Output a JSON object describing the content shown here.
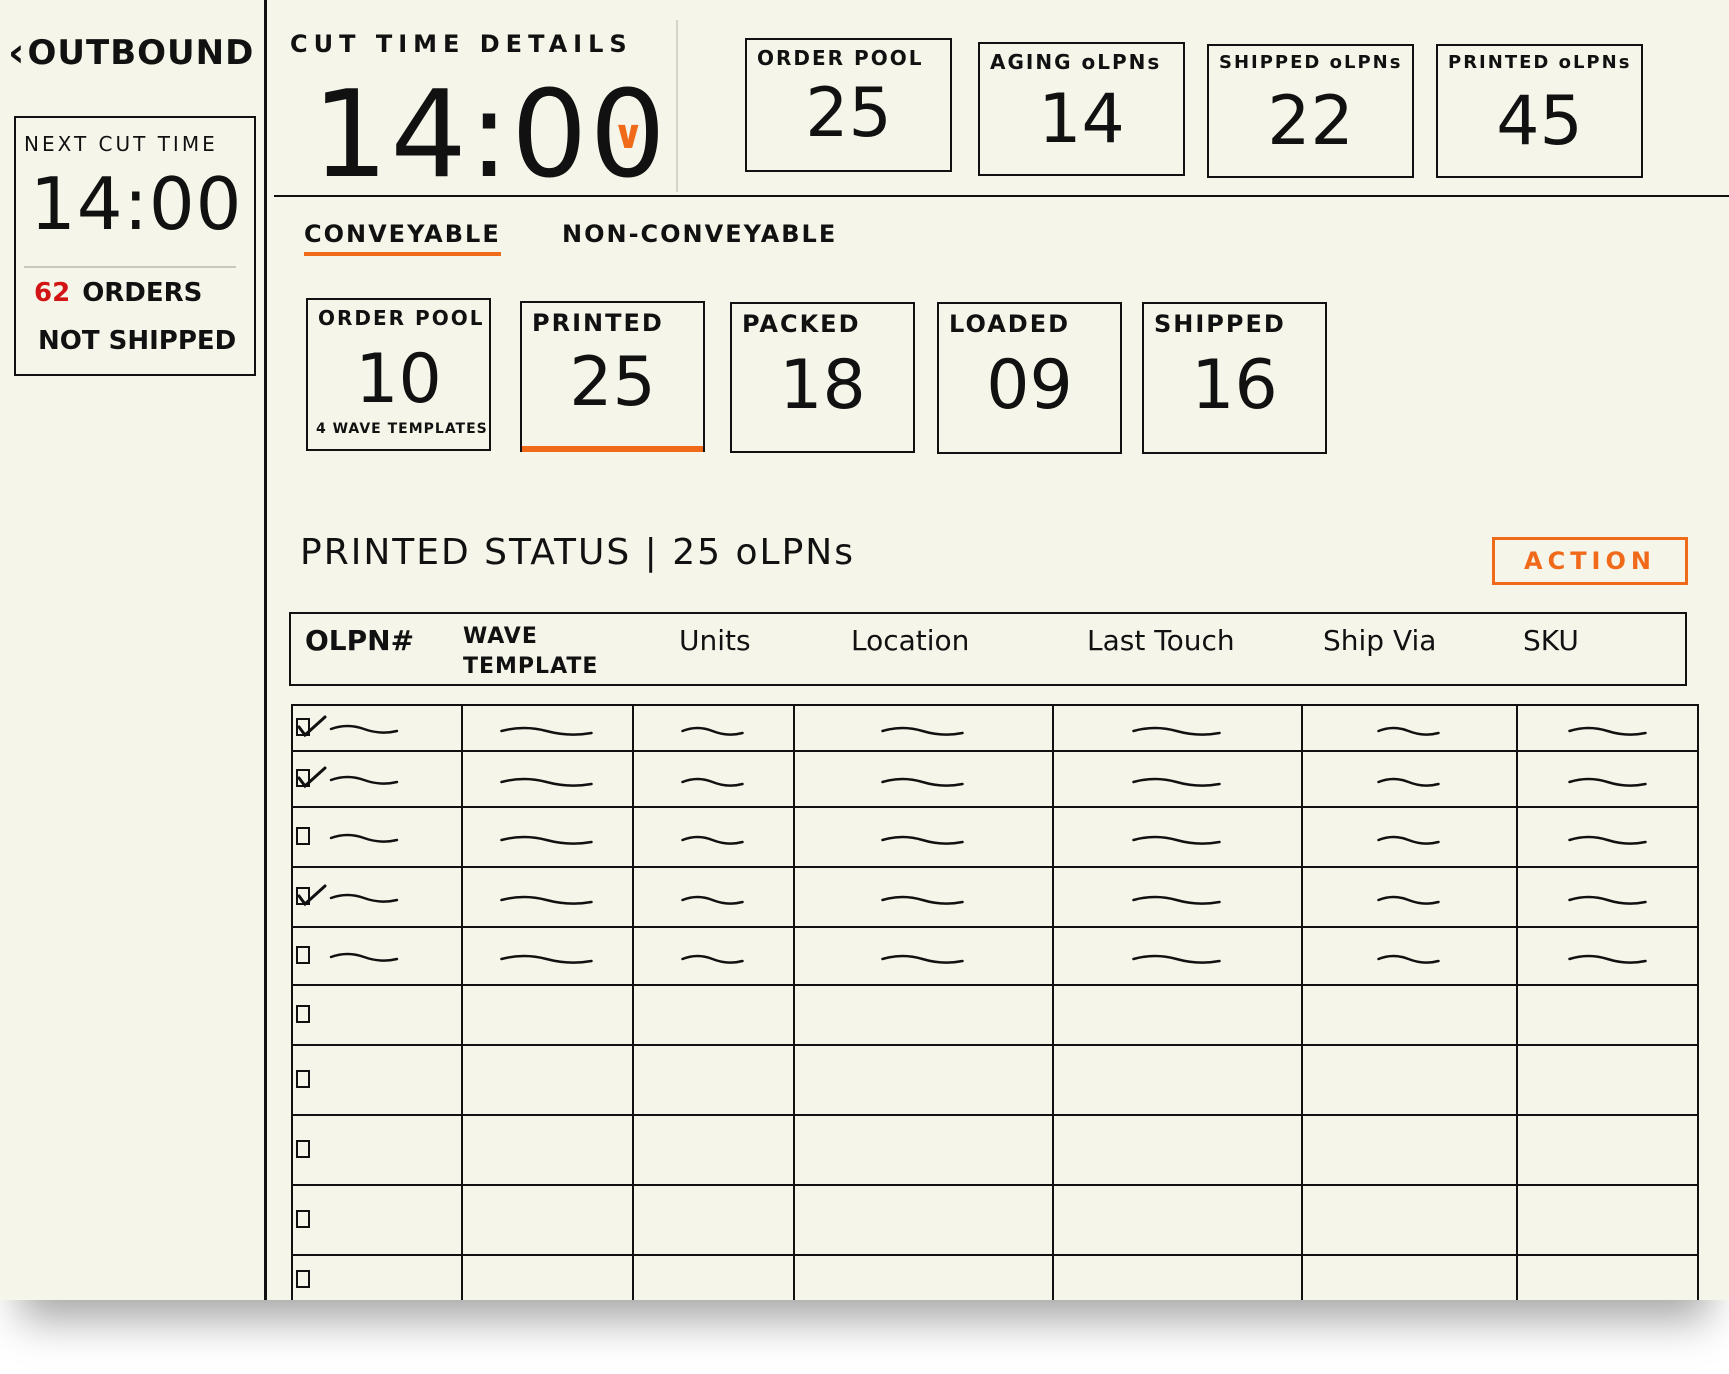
{
  "nav": {
    "back_label": "OUTBOUND"
  },
  "next_cut": {
    "label": "NEXT CUT TIME",
    "time": "14:00",
    "orders_count": "62",
    "orders_label": "ORDERS",
    "not_shipped_label": "NOT SHIPPED"
  },
  "cut_time": {
    "title": "CUT TIME DETAILS",
    "value": "14:00"
  },
  "top_stats": [
    {
      "label": "ORDER POOL",
      "value": "25"
    },
    {
      "label": "AGING oLPNs",
      "value": "14"
    },
    {
      "label": "SHIPPED oLPNs",
      "value": "22"
    },
    {
      "label": "PRINTED oLPNs",
      "value": "45"
    }
  ],
  "tabs": [
    {
      "label": "CONVEYABLE",
      "active": true
    },
    {
      "label": "NON-CONVEYABLE",
      "active": false
    }
  ],
  "stage_stats": [
    {
      "label": "ORDER POOL",
      "value": "10",
      "sub": "4 WAVE TEMPLATES"
    },
    {
      "label": "PRINTED",
      "value": "25",
      "selected": true
    },
    {
      "label": "PACKED",
      "value": "18"
    },
    {
      "label": "LOADED",
      "value": "09"
    },
    {
      "label": "SHIPPED",
      "value": "16"
    }
  ],
  "printed_status": {
    "title": "PRINTED STATUS | 25 oLPNs",
    "action_label": "ACTION"
  },
  "table": {
    "columns": [
      "OLPN#",
      "WAVE TEMPLATE",
      "Units",
      "Location",
      "Last Touch",
      "Ship Via",
      "SKU"
    ],
    "rows": [
      {
        "checked": true,
        "filled": true
      },
      {
        "checked": true,
        "filled": true
      },
      {
        "checked": false,
        "filled": true
      },
      {
        "checked": true,
        "filled": true
      },
      {
        "checked": false,
        "filled": true
      },
      {
        "checked": false,
        "filled": false
      },
      {
        "checked": false,
        "filled": false
      },
      {
        "checked": false,
        "filled": false
      },
      {
        "checked": false,
        "filled": false
      },
      {
        "checked": false,
        "filled": false
      }
    ]
  },
  "colors": {
    "accent": "#f06a1a",
    "alert": "#d21414",
    "paper": "#f5f5ea",
    "ink": "#111111"
  }
}
